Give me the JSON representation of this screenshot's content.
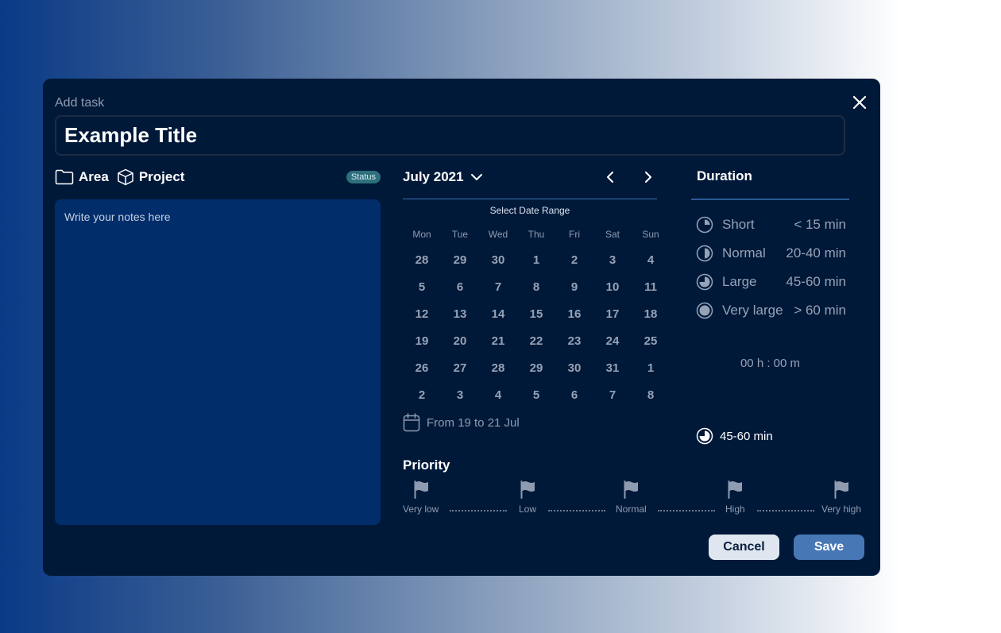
{
  "dialog": {
    "header_label": "Add task",
    "title_value": "Example Title"
  },
  "meta": {
    "area_label": "Area",
    "project_label": "Project",
    "status_label": "Status"
  },
  "notes": {
    "placeholder": "Write your notes here"
  },
  "calendar": {
    "month_label": "July 2021",
    "range_label": "Select Date Range",
    "weekdays": [
      "Mon",
      "Tue",
      "Wed",
      "Thu",
      "Fri",
      "Sat",
      "Sun"
    ],
    "days": [
      "28",
      "29",
      "30",
      "1",
      "2",
      "3",
      "4",
      "5",
      "6",
      "7",
      "8",
      "9",
      "10",
      "11",
      "12",
      "13",
      "14",
      "15",
      "16",
      "17",
      "18",
      "19",
      "20",
      "21",
      "22",
      "23",
      "24",
      "25",
      "26",
      "27",
      "28",
      "29",
      "30",
      "31",
      "1",
      "2",
      "3",
      "4",
      "5",
      "6",
      "7",
      "8"
    ],
    "range_summary": "From 19 to 21 Jul"
  },
  "duration": {
    "title": "Duration",
    "options": [
      {
        "label": "Short",
        "range": "< 15 min",
        "fill": 0.25
      },
      {
        "label": "Normal",
        "range": "20-40 min",
        "fill": 0.5
      },
      {
        "label": "Large",
        "range": "45-60 min",
        "fill": 0.75
      },
      {
        "label": "Very large",
        "range": "> 60 min",
        "fill": 1.0
      }
    ],
    "time_readout": "00 h : 00 m",
    "selected_label": "45-60 min"
  },
  "priority": {
    "title": "Priority",
    "levels": [
      "Very low",
      "Low",
      "Normal",
      "High",
      "Very high"
    ]
  },
  "actions": {
    "cancel_label": "Cancel",
    "save_label": "Save"
  },
  "colors": {
    "modal_bg": "#011939",
    "notes_bg": "#012d6b",
    "accent": "#4877b5",
    "status_badge": "#2d6f7b"
  }
}
